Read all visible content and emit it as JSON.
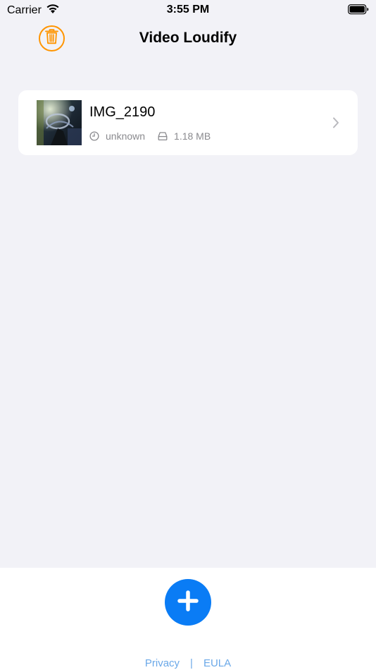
{
  "status_bar": {
    "carrier": "Carrier",
    "time": "3:55 PM",
    "icons": [
      "wifi-icon",
      "battery-icon"
    ]
  },
  "nav": {
    "title": "Video Loudify",
    "trash_icon": "trash-icon",
    "accent_color": "#ff9500"
  },
  "videos": [
    {
      "name": "IMG_2190",
      "duration": "unknown",
      "size": "1.18 MB",
      "icons": [
        "clock-icon",
        "storage-icon",
        "chevron-right-icon"
      ]
    }
  ],
  "bottom": {
    "add_icon": "plus-icon",
    "add_color": "#0a7cf5",
    "privacy_label": "Privacy",
    "separator": "|",
    "eula_label": "EULA",
    "link_color": "#6aa8e8"
  }
}
